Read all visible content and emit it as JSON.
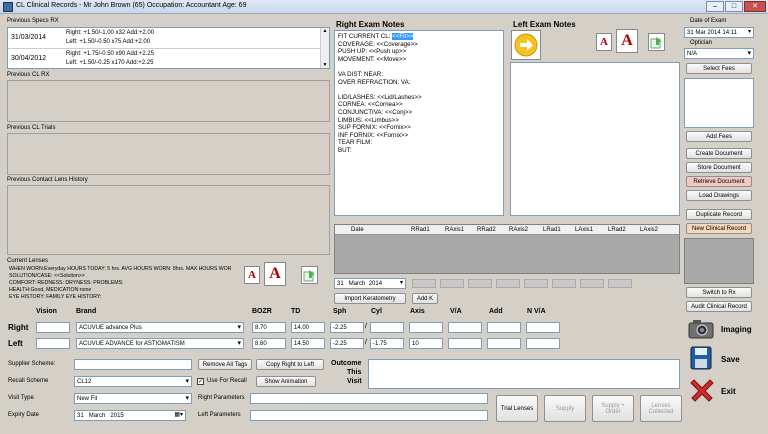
{
  "window": {
    "title": "CL Clinical Records - Mr John Brown (65)  Occupation: Accountant  Age: 69",
    "min": "–",
    "max": "□",
    "close": "✕"
  },
  "prev_specs": {
    "label": "Previous Specs RX",
    "rows": [
      {
        "date": "31/03/2014",
        "right": "Right:  +1.50/-1.00 x32  Add:+2.00",
        "left": "Left:    +1.50/-0.50 x75  Add:+2.00"
      },
      {
        "date": "30/04/2012",
        "right": "Right:  +1.75/-0.50 x90  Add:+2.25",
        "left": "Left:    +1.50/-0.25 x170  Add:+2.25"
      }
    ]
  },
  "prev_cl_rx": {
    "label": "Previous CL RX"
  },
  "prev_cl_trials": {
    "label": "Previous CL Trials"
  },
  "prev_cl_history": {
    "label": "Previous Contact Lens History"
  },
  "current_lenses": {
    "label": "Current Lenses",
    "lines": [
      "WHEN WORN:Everyday   HOURS TODAY: 5 hrs.  AVG HOURS WORN: 8hrs.  MAX HOURS WOR",
      "SOLUTION/CASE: <<Solution>>",
      "COMFORT:    REDNESS:   DRYNESS:   PROBLEMS:",
      "HEALTH:Good,  MEDICATION:none",
      "EYE HISTORY:  FAMILY EYE HISTORY:"
    ]
  },
  "right_notes": {
    "label": "Right Exam Notes",
    "first_prefix": "FIT CURRENT CL: ",
    "first_hl": "<<Fit>>",
    "lines": [
      "COVERAGE: <<Coverage>>",
      "PUSH UP: <<Push up>>",
      "MOVEMENT: <<Move>>",
      "",
      "VA DIST:   NEAR:",
      "OVER REFRACTION:   VA:",
      "",
      "LID/LASHES: <<Lid/Lashes>>",
      "CORNEA: <<Cornea>>",
      "CONJUNCTIVA: <<Conj>>",
      "LIMBUS: <<Limbus>>",
      "SUP FORNIX: <<Fornix>>",
      "INF FORNIX: <<Fornix>>",
      "TEAR FILM:",
      "BUT:"
    ]
  },
  "left_notes": {
    "label": "Left Exam Notes"
  },
  "font_labels": {
    "small": "A",
    "large": "A"
  },
  "kerato": {
    "headers": [
      "Date",
      "RRad1",
      "RAxis1",
      "RRad2",
      "RAxis2",
      "LRad1",
      "LAxis1",
      "LRad2",
      "LAxis2"
    ],
    "date_day": "31",
    "date_month": "March",
    "date_year": "2014",
    "import_label": "Import Keratometry",
    "add_k_label": "Add K"
  },
  "rx_grid": {
    "headers": {
      "vision": "Vision",
      "brand": "Brand",
      "bozr": "BOZR",
      "td": "TD",
      "sph": "Sph",
      "cyl": "Cyl",
      "axis": "Axis",
      "va": "V/A",
      "add": "Add",
      "nva": "N V/A"
    },
    "rows": [
      {
        "eye": "Right",
        "vision": "",
        "brand": "ACUVUE advance Plus",
        "bozr": "8.70",
        "td": "14.00",
        "sph": "-2.25",
        "sep": "/",
        "cyl": "",
        "axis": "",
        "va": "",
        "add": "",
        "nva": ""
      },
      {
        "eye": "Left",
        "vision": "",
        "brand": "ACUVUE ADVANCE for ASTIGMATISM",
        "bozr": "8.60",
        "td": "14.50",
        "sph": "-2.25",
        "sep": "/",
        "cyl": "-1.75",
        "axis": "10",
        "va": "",
        "add": "",
        "nva": ""
      }
    ]
  },
  "form": {
    "supplier_label": "Supplier Scheme:",
    "supplier_value": "",
    "recall_label": "Recall Scheme",
    "recall_value": "CL12",
    "use_recall_label": "Use For Recall",
    "use_recall_check": "✓",
    "visit_label": "Visit Type",
    "visit_value": "New Fit",
    "expiry_label": "Expiry Date",
    "expiry_day": "31",
    "expiry_month": "March",
    "expiry_year": "2015",
    "right_params_label": "Right Parameters",
    "left_params_label": "Left Parameters",
    "outcome_label_1": "Outcome",
    "outcome_label_2": "This",
    "outcome_label_3": "Visit",
    "remove_tags": "Remove All Tags",
    "copy_rl": "Copy Right to Left",
    "show_anim": "Show Animation"
  },
  "bottom_buttons": {
    "trial": "Trial Lenses",
    "supply": "Supply",
    "supply_order_1": "Supply +",
    "supply_order_2": "Order",
    "collected_1": "Lenses",
    "collected_2": "Collected"
  },
  "sidebar": {
    "date_label": "Date of Exam",
    "date_value": "31 Mar 2014  14:11",
    "optician_label": "Optician",
    "optician_value": "N/A",
    "select_fees": "Select Fees",
    "add_fees": "Add Fees",
    "create_doc": "Create Document",
    "store_doc": "Store Document",
    "retrieve_doc": "Retrieve Document",
    "load_drawings": "Load Drawings",
    "duplicate": "Duplicate Record",
    "new_clinical": "New Clinical Record",
    "switch_rx": "Switch to Rx",
    "audit": "Audit Clinical Record",
    "imaging": "Imaging",
    "save": "Save",
    "exit": "Exit"
  },
  "colors": {
    "accent": "#3399ff",
    "font_icon": "#aa0000",
    "pink_button": "#f4c6c6",
    "orange_button": "#f6d7b9"
  }
}
